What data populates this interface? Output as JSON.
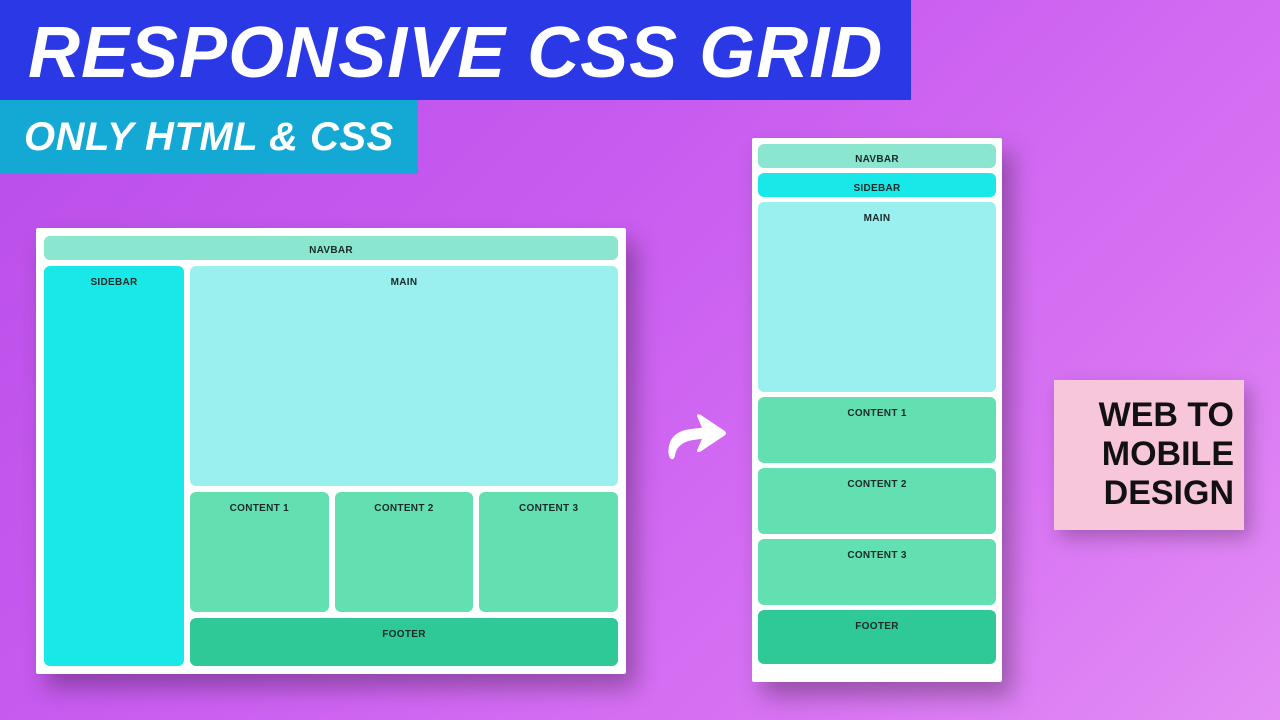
{
  "header": {
    "title": "RESPONSIVE CSS GRID",
    "subtitle": "ONLY HTML & CSS"
  },
  "desktop": {
    "navbar": "NAVBAR",
    "sidebar": "SIDEBAR",
    "main": "MAIN",
    "content1": "CONTENT 1",
    "content2": "CONTENT 2",
    "content3": "CONTENT 3",
    "footer": "FOOTER"
  },
  "mobile": {
    "navbar": "NAVBAR",
    "sidebar": "SIDEBAR",
    "main": "MAIN",
    "content1": "CONTENT 1",
    "content2": "CONTENT 2",
    "content3": "CONTENT 3",
    "footer": "FOOTER"
  },
  "badge": {
    "line1": "WEB TO",
    "line2": "MOBILE",
    "line3": "DESIGN"
  },
  "colors": {
    "title_bg": "#2a38e6",
    "subtitle_bg": "#14a8d4",
    "navbar": "#8ae6cf",
    "sidebar": "#19e8e8",
    "main": "#9aefef",
    "content": "#63e0b1",
    "footer": "#2fc897",
    "badge_bg": "#f7c6db"
  }
}
